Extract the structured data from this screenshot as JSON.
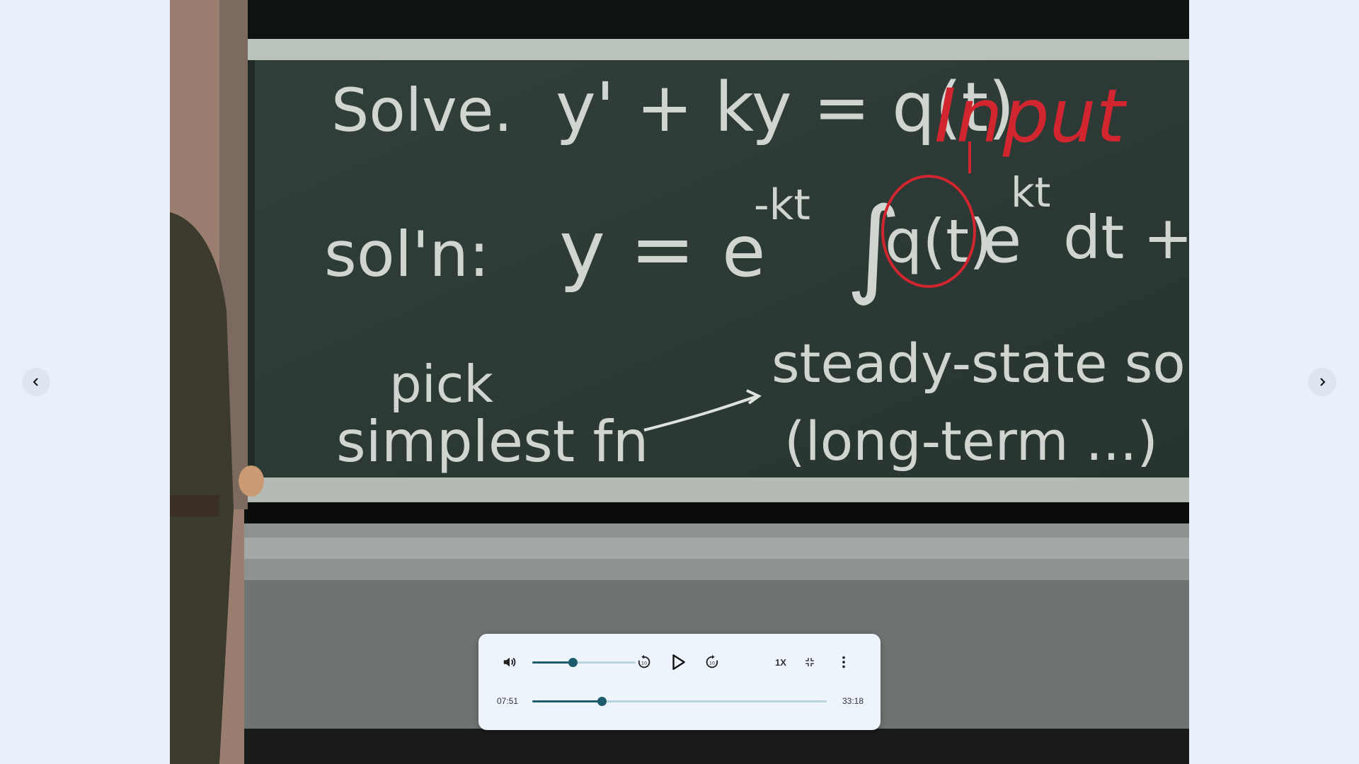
{
  "video": {
    "board_lines": {
      "solve_label": "Solve.",
      "equation": "y' + ky = q(t)",
      "annotation": "Input",
      "soln_label": "sol'n:",
      "solution_lhs": "y =",
      "exp_prefix": "e",
      "exp_prefix_power": "-kt",
      "integral": "∫",
      "circled": "q(t)",
      "exp_inner": "e",
      "exp_inner_power": "kt",
      "dt": "dt +",
      "pick": "pick",
      "simplest": "simplest fn",
      "steady_state": "steady-state soln",
      "long_term": "(long-term ...)"
    }
  },
  "nav": {
    "prev_icon": "chevron-left-icon",
    "next_icon": "chevron-right-icon"
  },
  "player": {
    "volume_icon": "volume-icon",
    "volume_level": 0.39,
    "rewind_icon": "replay-10-icon",
    "play_icon": "play-icon",
    "forward_icon": "forward-10-icon",
    "speed": "1X",
    "exit_fullscreen_icon": "fullscreen-exit-icon",
    "more_icon": "more-vert-icon",
    "current_time": "07:51",
    "duration": "33:18",
    "progress": 0.235,
    "accent": "#1d5c6d"
  }
}
